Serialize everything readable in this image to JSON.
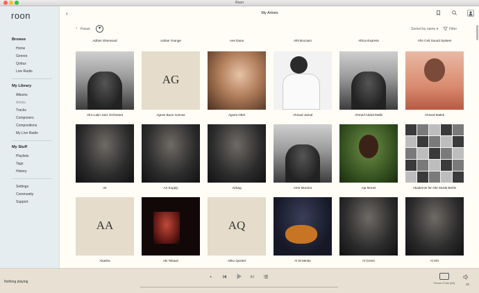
{
  "window": {
    "title": "Roon"
  },
  "sidebar": {
    "logo": "roon",
    "sections": [
      {
        "heading": "Browse",
        "items": [
          "Home",
          "Genres",
          "Qobuz",
          "Live Radio"
        ]
      },
      {
        "heading": "My Library",
        "items": [
          "Albums",
          "Artists",
          "Tracks",
          "Composers",
          "Compositions",
          "My Live Radio"
        ],
        "active": "Artists"
      },
      {
        "heading": "My Stuff",
        "items": [
          "Playlists",
          "Tags",
          "History"
        ]
      },
      {
        "heading": "",
        "items": [
          "Settings",
          "Community",
          "Support"
        ]
      }
    ]
  },
  "header": {
    "title": "My Artists",
    "focus_label": "Focus",
    "sort_label": "Sorted by name ▾",
    "filter_label": "Filter",
    "icons": [
      "back-icon",
      "bookmark-icon",
      "search-icon",
      "profile-icon",
      "heart-icon",
      "filter-icon"
    ]
  },
  "artists": {
    "top_row": [
      "Adrian Sherwood",
      "Adrian Younge",
      "Aes Dana",
      "Afel Bocoum",
      "Africa Express",
      "Afro Celt Sound System"
    ],
    "grid": [
      {
        "name": "Afro-Latin Jazz Orchestra",
        "initials": "",
        "palette": "photo-bw"
      },
      {
        "name": "Agnes Buen Garnas",
        "initials": "AG",
        "palette": "placeholder"
      },
      {
        "name": "Agnes Obel",
        "initials": "",
        "palette": "photo-warm"
      },
      {
        "name": "Ahmad Jamal",
        "initials": "",
        "palette": "photo-light"
      },
      {
        "name": "Ahmed Abdul-Malik",
        "initials": "",
        "palette": "photo-bw"
      },
      {
        "name": "Ahmed Malek",
        "initials": "",
        "palette": "photo-red"
      },
      {
        "name": "Air",
        "initials": "",
        "palette": "photo-dark"
      },
      {
        "name": "Air Supply",
        "initials": "",
        "palette": "photo-dark"
      },
      {
        "name": "Airbag",
        "initials": "",
        "palette": "photo-dark"
      },
      {
        "name": "Airto Moreira",
        "initials": "",
        "palette": "photo-bw"
      },
      {
        "name": "Aja Monet",
        "initials": "",
        "palette": "photo-green"
      },
      {
        "name": "Akademie für Alte Musik Berlin",
        "initials": "",
        "palette": "photo-grid"
      },
      {
        "name": "Akasha",
        "initials": "AA",
        "palette": "placeholder"
      },
      {
        "name": "Aki Takase",
        "initials": "",
        "palette": "photo-stage"
      },
      {
        "name": "Akku Quintet",
        "initials": "AQ",
        "palette": "placeholder"
      },
      {
        "name": "Al Di Meola",
        "initials": "",
        "palette": "photo-guitar"
      },
      {
        "name": "Al Green",
        "initials": "",
        "palette": "photo-dark"
      },
      {
        "name": "Al Hirt",
        "initials": "",
        "palette": "photo-dark"
      }
    ]
  },
  "player": {
    "now_playing": "Nothing playing",
    "zone_label": "Fernan iTube (N4)",
    "volume": "30",
    "controls": [
      "shuffle-icon",
      "previous-icon",
      "play-icon",
      "next-icon",
      "queue-icon"
    ]
  },
  "colors": {
    "sidebar_bg": "#e6edf0",
    "main_bg": "#fffdf6",
    "placeholder_bg": "#e5dccb",
    "bottom_bg": "#e8e1d3"
  }
}
